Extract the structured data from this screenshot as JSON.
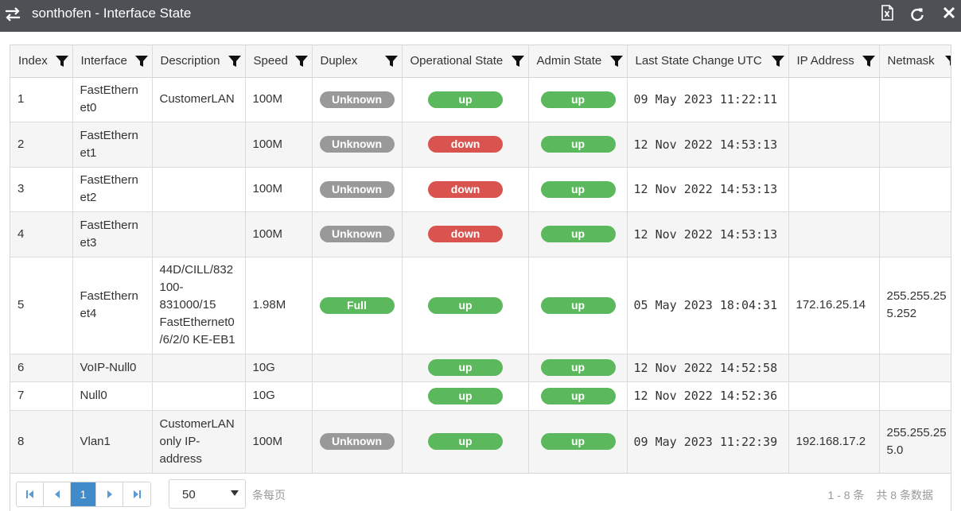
{
  "window": {
    "title": "sonthofen - Interface State"
  },
  "columns": [
    {
      "label": "Index"
    },
    {
      "label": "Interface"
    },
    {
      "label": "Description"
    },
    {
      "label": "Speed"
    },
    {
      "label": "Duplex"
    },
    {
      "label": "Operational State"
    },
    {
      "label": "Admin State"
    },
    {
      "label": "Last State Change UTC"
    },
    {
      "label": "IP Address"
    },
    {
      "label": "Netmask"
    }
  ],
  "rows": [
    {
      "index": "1",
      "interface": [
        "FastEthern",
        "et0"
      ],
      "description": [
        "CustomerLAN"
      ],
      "speed": "100M",
      "duplex": "Unknown",
      "oper": "up",
      "admin": "up",
      "last_change": "09 May 2023 11:22:11",
      "ip": "",
      "netmask": []
    },
    {
      "index": "2",
      "interface": [
        "FastEthern",
        "et1"
      ],
      "description": [],
      "speed": "100M",
      "duplex": "Unknown",
      "oper": "down",
      "admin": "up",
      "last_change": "12 Nov 2022 14:53:13",
      "ip": "",
      "netmask": []
    },
    {
      "index": "3",
      "interface": [
        "FastEthern",
        "et2"
      ],
      "description": [],
      "speed": "100M",
      "duplex": "Unknown",
      "oper": "down",
      "admin": "up",
      "last_change": "12 Nov 2022 14:53:13",
      "ip": "",
      "netmask": []
    },
    {
      "index": "4",
      "interface": [
        "FastEthern",
        "et3"
      ],
      "description": [],
      "speed": "100M",
      "duplex": "Unknown",
      "oper": "down",
      "admin": "up",
      "last_change": "12 Nov 2022 14:53:13",
      "ip": "",
      "netmask": []
    },
    {
      "index": "5",
      "interface": [
        "FastEthern",
        "et4"
      ],
      "description": [
        "44D/CILL/832",
        "100-",
        "831000/15",
        "FastEthernet0",
        "/6/2/0 KE-EB1"
      ],
      "speed": "1.98M",
      "duplex": "Full",
      "oper": "up",
      "admin": "up",
      "last_change": "05 May 2023 18:04:31",
      "ip": "172.16.25.14",
      "netmask": [
        "255.255.25",
        "5.252"
      ]
    },
    {
      "index": "6",
      "interface": [
        "VoIP-Null0"
      ],
      "description": [],
      "speed": "10G",
      "duplex": "",
      "oper": "up",
      "admin": "up",
      "last_change": "12 Nov 2022 14:52:58",
      "ip": "",
      "netmask": []
    },
    {
      "index": "7",
      "interface": [
        "Null0"
      ],
      "description": [],
      "speed": "10G",
      "duplex": "",
      "oper": "up",
      "admin": "up",
      "last_change": "12 Nov 2022 14:52:36",
      "ip": "",
      "netmask": []
    },
    {
      "index": "8",
      "interface": [
        "Vlan1"
      ],
      "description": [
        "CustomerLAN",
        "only IP-",
        "address"
      ],
      "speed": "100M",
      "duplex": "Unknown",
      "oper": "up",
      "admin": "up",
      "last_change": "09 May 2023 11:22:39",
      "ip": "192.168.17.2",
      "netmask": [
        "255.255.25",
        "5.0"
      ]
    }
  ],
  "status_colors": {
    "Unknown": "#999999",
    "Full": "#5cb85c",
    "up": "#5cb85c",
    "down": "#d9534f"
  },
  "pager": {
    "first_icon": "first-page-icon",
    "prev_icon": "prev-page-icon",
    "current_page": "1",
    "next_icon": "next-page-icon",
    "last_icon": "last-page-icon",
    "page_size": "50",
    "page_size_label": "条每页",
    "range": "1 - 8 条",
    "total": "共 8 条数据"
  },
  "icons": {
    "swap": "swap-arrows-icon",
    "excel": "excel-export-icon",
    "refresh": "refresh-icon",
    "close": "close-icon",
    "filter": "filter-icon"
  }
}
